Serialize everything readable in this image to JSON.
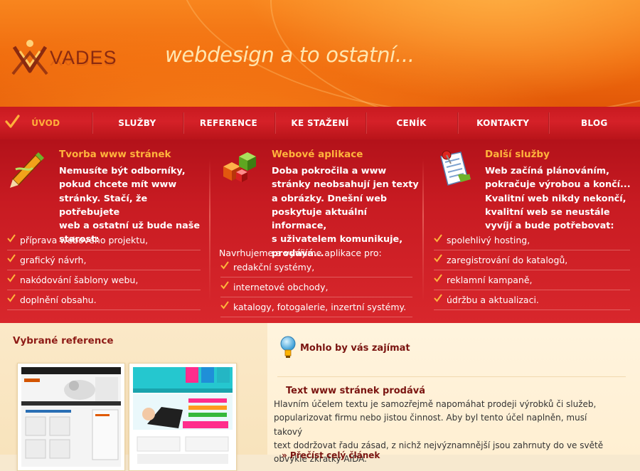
{
  "header": {
    "logo_text": "VADES",
    "slogan": "webdesign a to ostatní..."
  },
  "nav": {
    "items": [
      "ÚVOD",
      "SLUŽBY",
      "REFERENCE",
      "KE STAŽENÍ",
      "CENÍK",
      "KONTAKTY",
      "BLOG"
    ],
    "active_index": 0
  },
  "features": {
    "web": {
      "icon": "pencil-icon",
      "title": "Tvorba www stránek",
      "text_lines": [
        "Nemusíte být odborníky,",
        "pokud chcete mít  www",
        "stránky. Stačí, že potřebujete",
        "web a ostatní už bude naše",
        "starost:"
      ],
      "bullets": [
        "příprava webového projektu,",
        "grafický návrh,",
        "nakódování šablony webu,",
        "doplnění obsahu."
      ]
    },
    "apps": {
      "icon": "cubes-icon",
      "title": "Webové aplikace",
      "text_lines": [
        "Doba pokročila a www",
        "stránky neobsahují jen texty",
        "a obrázky. Dnešní web",
        "poskytuje aktuální informace,",
        "s uživatelem komunikuje,",
        "prodává..."
      ],
      "intro": "Navrhujeme a vyvíjíme aplikace pro:",
      "bullets": [
        "redakční systémy,",
        "internetové obchody,",
        "katalogy, fotogalerie, inzertní systémy."
      ]
    },
    "other": {
      "icon": "clipboard-icon",
      "title": "Další služby",
      "text_lines": [
        "Web začíná plánováním,",
        "pokračuje výrobou a končí...",
        "Kvalitní web nikdy nekončí,",
        "kvalitní web se neustále",
        "vyvíjí a bude potřebovat:"
      ],
      "bullets": [
        "spolehlivý hosting,",
        "zaregistrování do katalogů,",
        "reklamní kampaně,",
        "údržbu a aktualizaci."
      ]
    }
  },
  "refs": {
    "title": "Vybrané reference"
  },
  "interest": {
    "icon": "lightbulb-icon",
    "title": "Mohlo by vás zajímat",
    "article_title": "Text www stránek prodává",
    "article_lines": [
      "Hlavním účelem textu je samozřejmě napomáhat prodeji výrobků či služeb,",
      "popularizovat firmu nebo jistou činnost. Aby byl tento účel naplněn, musí takový",
      "text dodržovat řadu zásad, z nichž nejvýznamnější jsou zahrnuty do ve světě",
      "obvyklé zkratky AIDA."
    ],
    "more_label": "» Přečíst celý článek"
  },
  "colors": {
    "header_orange": "#f06c0e",
    "nav_red": "#c81a20",
    "band_red": "#c81b22",
    "accent_gold": "#ffb43c",
    "heading_brown": "#7a1410"
  }
}
